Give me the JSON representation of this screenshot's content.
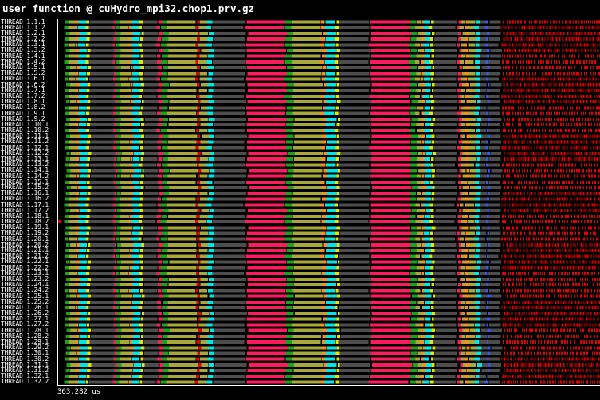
{
  "window": {
    "title": "user function @ cuHydro_mpi32.chop1.prv.gz"
  },
  "timeline": {
    "end_time_label": "363.282 us",
    "threads": [
      "THREAD 1.1.1",
      "THREAD 1.1.2",
      "THREAD 1.2.1",
      "THREAD 1.2.2",
      "THREAD 1.3.1",
      "THREAD 1.3.2",
      "THREAD 1.4.1",
      "THREAD 1.4.2",
      "THREAD 1.5.1",
      "THREAD 1.5.2",
      "THREAD 1.6.1",
      "THREAD 1.6.2",
      "THREAD 1.7.1",
      "THREAD 1.7.2",
      "THREAD 1.8.1",
      "THREAD 1.8.2",
      "THREAD 1.9.1",
      "THREAD 1.9.2",
      "THREAD 1.10.1",
      "THREAD 1.10.2",
      "THREAD 1.11.1",
      "THREAD 1.11.2",
      "THREAD 1.12.1",
      "THREAD 1.12.2",
      "THREAD 1.13.1",
      "THREAD 1.13.2",
      "THREAD 1.14.1",
      "THREAD 1.14.2",
      "THREAD 1.15.1",
      "THREAD 1.15.2",
      "THREAD 1.16.1",
      "THREAD 1.16.2",
      "THREAD 1.17.1",
      "THREAD 1.17.2",
      "THREAD 1.18.1",
      "THREAD 1.18.2",
      "THREAD 1.19.1",
      "THREAD 1.19.2",
      "THREAD 1.20.1",
      "THREAD 1.20.2",
      "THREAD 1.21.1",
      "THREAD 1.21.2",
      "THREAD 1.22.1",
      "THREAD 1.22.2",
      "THREAD 1.23.1",
      "THREAD 1.23.2",
      "THREAD 1.24.1",
      "THREAD 1.24.2",
      "THREAD 1.25.1",
      "THREAD 1.25.2",
      "THREAD 1.26.1",
      "THREAD 1.26.2",
      "THREAD 1.27.1",
      "THREAD 1.27.2",
      "THREAD 1.28.1",
      "THREAD 1.28.2",
      "THREAD 1.29.1",
      "THREAD 1.29.2",
      "THREAD 1.30.1",
      "THREAD 1.30.2",
      "THREAD 1.31.1",
      "THREAD 1.31.2",
      "THREAD 1.32.1",
      "THREAD 1.32.2"
    ],
    "colors": {
      "background": "#000000",
      "idle": "#4d4d4d",
      "green": "#1aa31a",
      "cyan": "#00e6e6",
      "orange": "#ff8c1a",
      "olive": "#a8a83a",
      "magenta": "#ff1a5e",
      "red": "#e60000",
      "yellow": "#e6e600",
      "blue": "#2e5cff"
    }
  }
}
